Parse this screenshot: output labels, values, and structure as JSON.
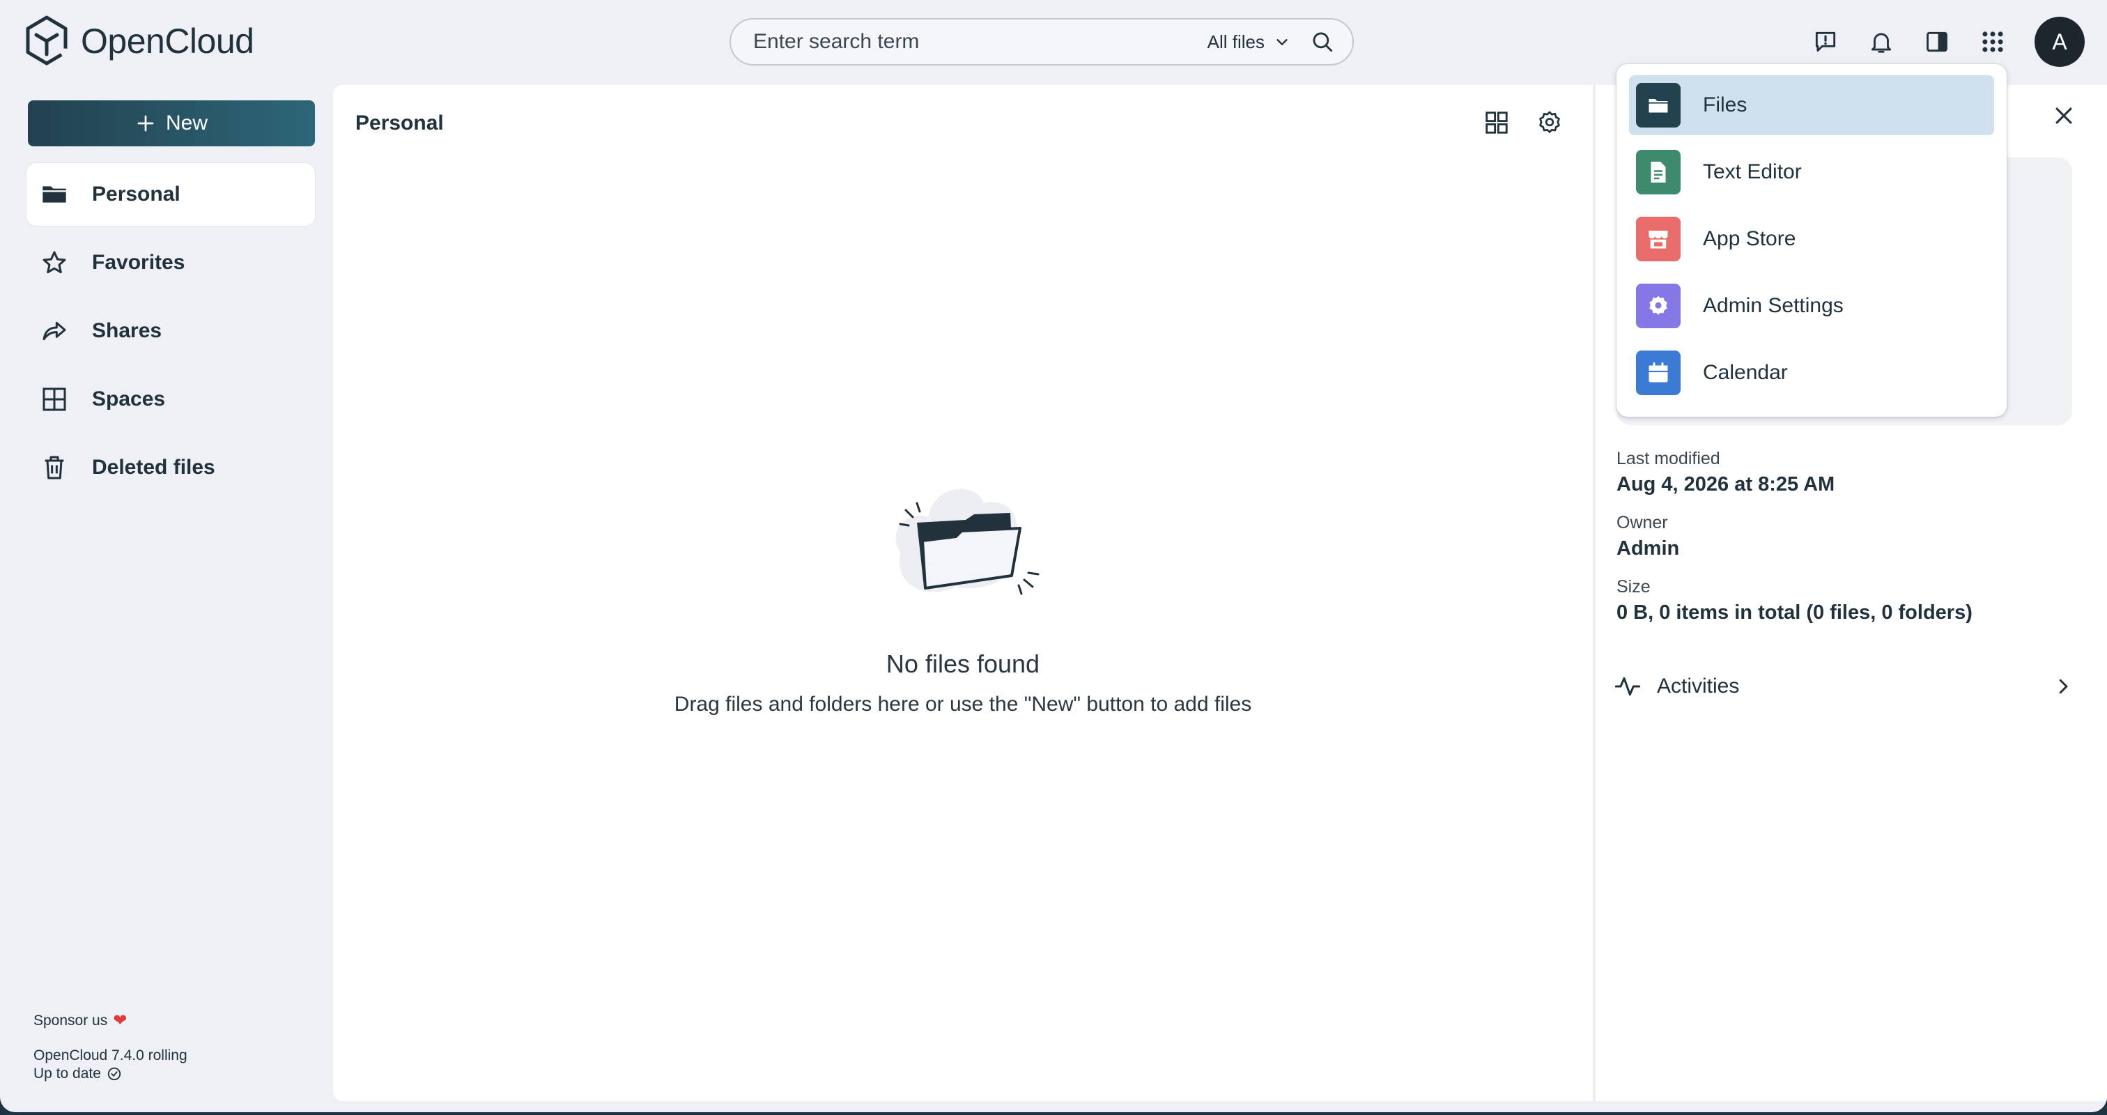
{
  "brand": {
    "name": "OpenCloud"
  },
  "search": {
    "placeholder": "Enter search term",
    "scope_label": "All files"
  },
  "topbar": {
    "icons": [
      "feedback-icon",
      "bell-icon",
      "sidebar-toggle-icon",
      "app-grid-icon"
    ],
    "avatar_initial": "A"
  },
  "sidebar": {
    "new_label": "New",
    "items": [
      {
        "label": "Personal",
        "icon": "folder-icon",
        "active": true
      },
      {
        "label": "Favorites",
        "icon": "star-icon",
        "active": false
      },
      {
        "label": "Shares",
        "icon": "share-icon",
        "active": false
      },
      {
        "label": "Spaces",
        "icon": "spaces-icon",
        "active": false
      },
      {
        "label": "Deleted files",
        "icon": "trash-icon",
        "active": false
      }
    ],
    "footer": {
      "sponsor": "Sponsor us",
      "version": "OpenCloud 7.4.0 rolling",
      "status": "Up to date"
    }
  },
  "main": {
    "title": "Personal",
    "empty_title": "No files found",
    "empty_subtitle": "Drag files and folders here or use the \"New\" button to add files"
  },
  "details": {
    "last_modified_label": "Last modified",
    "last_modified_value": "Aug 4, 2026 at 8:25 AM",
    "owner_label": "Owner",
    "owner_value": "Admin",
    "size_label": "Size",
    "size_value": "0 B, 0 items in total (0 files, 0 folders)",
    "activities_label": "Activities"
  },
  "app_menu": {
    "items": [
      {
        "label": "Files",
        "icon": "files-app-icon",
        "color": "#22424f",
        "active": true
      },
      {
        "label": "Text Editor",
        "icon": "document-icon",
        "color": "#3e8a6c",
        "active": false
      },
      {
        "label": "App Store",
        "icon": "store-icon",
        "color": "#e86d6a",
        "active": false
      },
      {
        "label": "Admin Settings",
        "icon": "gear-icon",
        "color": "#8478e6",
        "active": false
      },
      {
        "label": "Calendar",
        "icon": "calendar-icon",
        "color": "#3b7bd4",
        "active": false
      }
    ]
  },
  "colors": {
    "accent": "#22424f",
    "background": "#eef0f5",
    "menu_active": "#cfe0ee"
  }
}
